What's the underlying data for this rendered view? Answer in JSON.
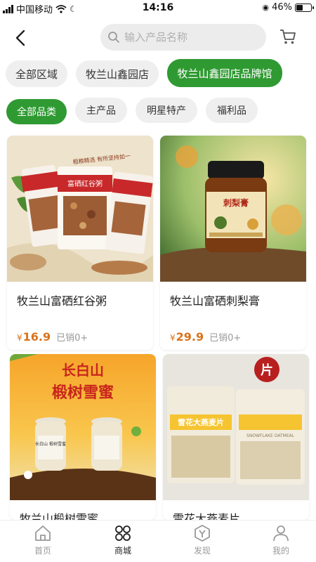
{
  "status_bar": {
    "carrier": "中国移动",
    "time": "14:16",
    "battery": "46%",
    "battery_level": 0.46
  },
  "header": {
    "search_placeholder": "输入产品名称"
  },
  "region_filters": [
    "全部区域",
    "牧兰山鑫园店",
    "牧兰山鑫园店品牌馆"
  ],
  "category_filters": [
    "全部品类",
    "主产品",
    "明星特产",
    "福利品"
  ],
  "products": [
    {
      "title": "牧兰山富硒红谷粥",
      "price_symbol": "¥",
      "price": "16.9",
      "sold": "已销0+",
      "image_text": "富硒红谷粥",
      "image_text2": "粗粮精选 有所坚持如一"
    },
    {
      "title": "牧兰山富硒刺梨膏",
      "price_symbol": "¥",
      "price": "29.9",
      "sold": "已销0+",
      "image_text": "刺梨膏"
    },
    {
      "title": "牧兰山椴树雪蜜",
      "image_text": "长白山",
      "image_text2": "椴树雪蜜",
      "jar_label": "长白山 椴树雪蜜"
    },
    {
      "title": "雪花大燕麦片",
      "image_text": "片",
      "bag_label": "雪花大燕麦片",
      "bag_sub": "SNOWFLAKE OATMEAL"
    }
  ],
  "tabbar": [
    {
      "label": "首页",
      "icon": "home-icon"
    },
    {
      "label": "商城",
      "icon": "mall-grid-icon"
    },
    {
      "label": "发现",
      "icon": "discover-icon"
    },
    {
      "label": "我的",
      "icon": "profile-icon"
    }
  ],
  "colors": {
    "accent": "#2f9a32",
    "price": "#d9731b"
  }
}
